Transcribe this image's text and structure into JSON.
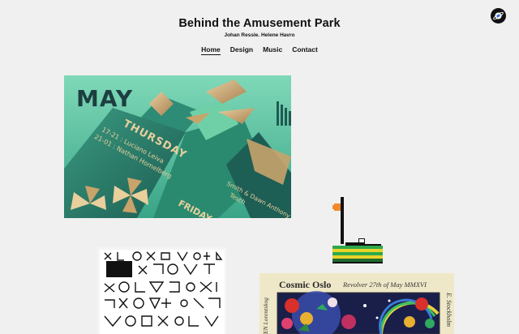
{
  "header": {
    "title": "Behind the Amusement Park",
    "subtitle": "Johan Ressle. Helene Havro"
  },
  "nav": {
    "items": [
      {
        "label": "Home",
        "active": true
      },
      {
        "label": "Design",
        "active": false
      },
      {
        "label": "Music",
        "active": false
      },
      {
        "label": "Contact",
        "active": false
      }
    ]
  },
  "logo": {
    "icon": "planet-logo-icon"
  },
  "posters": {
    "may": {
      "month": "MAY",
      "day": "THURSDAY",
      "line1": "17-21 : Luciano Leiva",
      "line2": "21-01 : Nathan Homelberg",
      "day2": "FRIDAY",
      "line3": "Smith & Dawn Anthony",
      "line4": "Tesch"
    },
    "oslo": {
      "title": "Cosmic Oslo",
      "date": "Revolver 27th of May MMXVI",
      "left_side": "STEN Lorentskog",
      "right_side": "E. Stockholm"
    }
  },
  "colors": {
    "background": "#f0f0f0",
    "teal_dark": "#1f5a52",
    "teal": "#2f9a82",
    "mint": "#7fd3b0",
    "gold": "#c8a36a"
  }
}
